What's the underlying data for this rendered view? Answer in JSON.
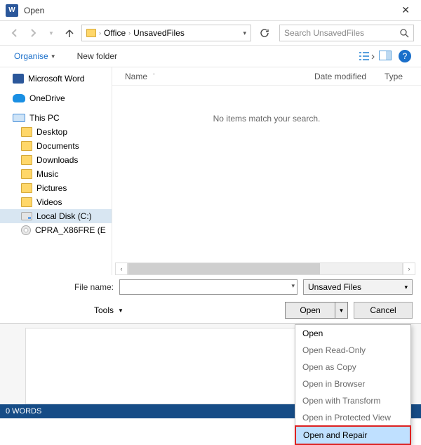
{
  "window": {
    "title": "Open"
  },
  "nav": {
    "crumbs": [
      "Office",
      "UnsavedFiles"
    ],
    "search_placeholder": "Search UnsavedFiles"
  },
  "toolbar": {
    "organise": "Organise",
    "new_folder": "New folder"
  },
  "tree": {
    "items": [
      {
        "label": "Microsoft Word",
        "icon": "word"
      },
      {
        "label": "OneDrive",
        "icon": "onedrive"
      },
      {
        "label": "This PC",
        "icon": "pc"
      },
      {
        "label": "Desktop",
        "icon": "folder",
        "level": 2
      },
      {
        "label": "Documents",
        "icon": "folder",
        "level": 2
      },
      {
        "label": "Downloads",
        "icon": "folder",
        "level": 2
      },
      {
        "label": "Music",
        "icon": "folder",
        "level": 2
      },
      {
        "label": "Pictures",
        "icon": "folder",
        "level": 2
      },
      {
        "label": "Videos",
        "icon": "folder",
        "level": 2
      },
      {
        "label": "Local Disk (C:)",
        "icon": "disk",
        "level": 2,
        "selected": true
      },
      {
        "label": "CPRA_X86FRE (E",
        "icon": "dvd",
        "level": 2
      }
    ]
  },
  "list": {
    "columns": {
      "name": "Name",
      "date": "Date modified",
      "type": "Type"
    },
    "empty_message": "No items match your search."
  },
  "form": {
    "filename_label": "File name:",
    "filename_value": "",
    "filter_label": "Unsaved Files",
    "tools_label": "Tools",
    "open_label": "Open",
    "cancel_label": "Cancel"
  },
  "open_menu": {
    "items": [
      "Open",
      "Open Read-Only",
      "Open as Copy",
      "Open in Browser",
      "Open with Transform",
      "Open in Protected View",
      "Open and Repair"
    ],
    "highlighted_index": 6
  },
  "status": {
    "words": "0 WORDS"
  }
}
